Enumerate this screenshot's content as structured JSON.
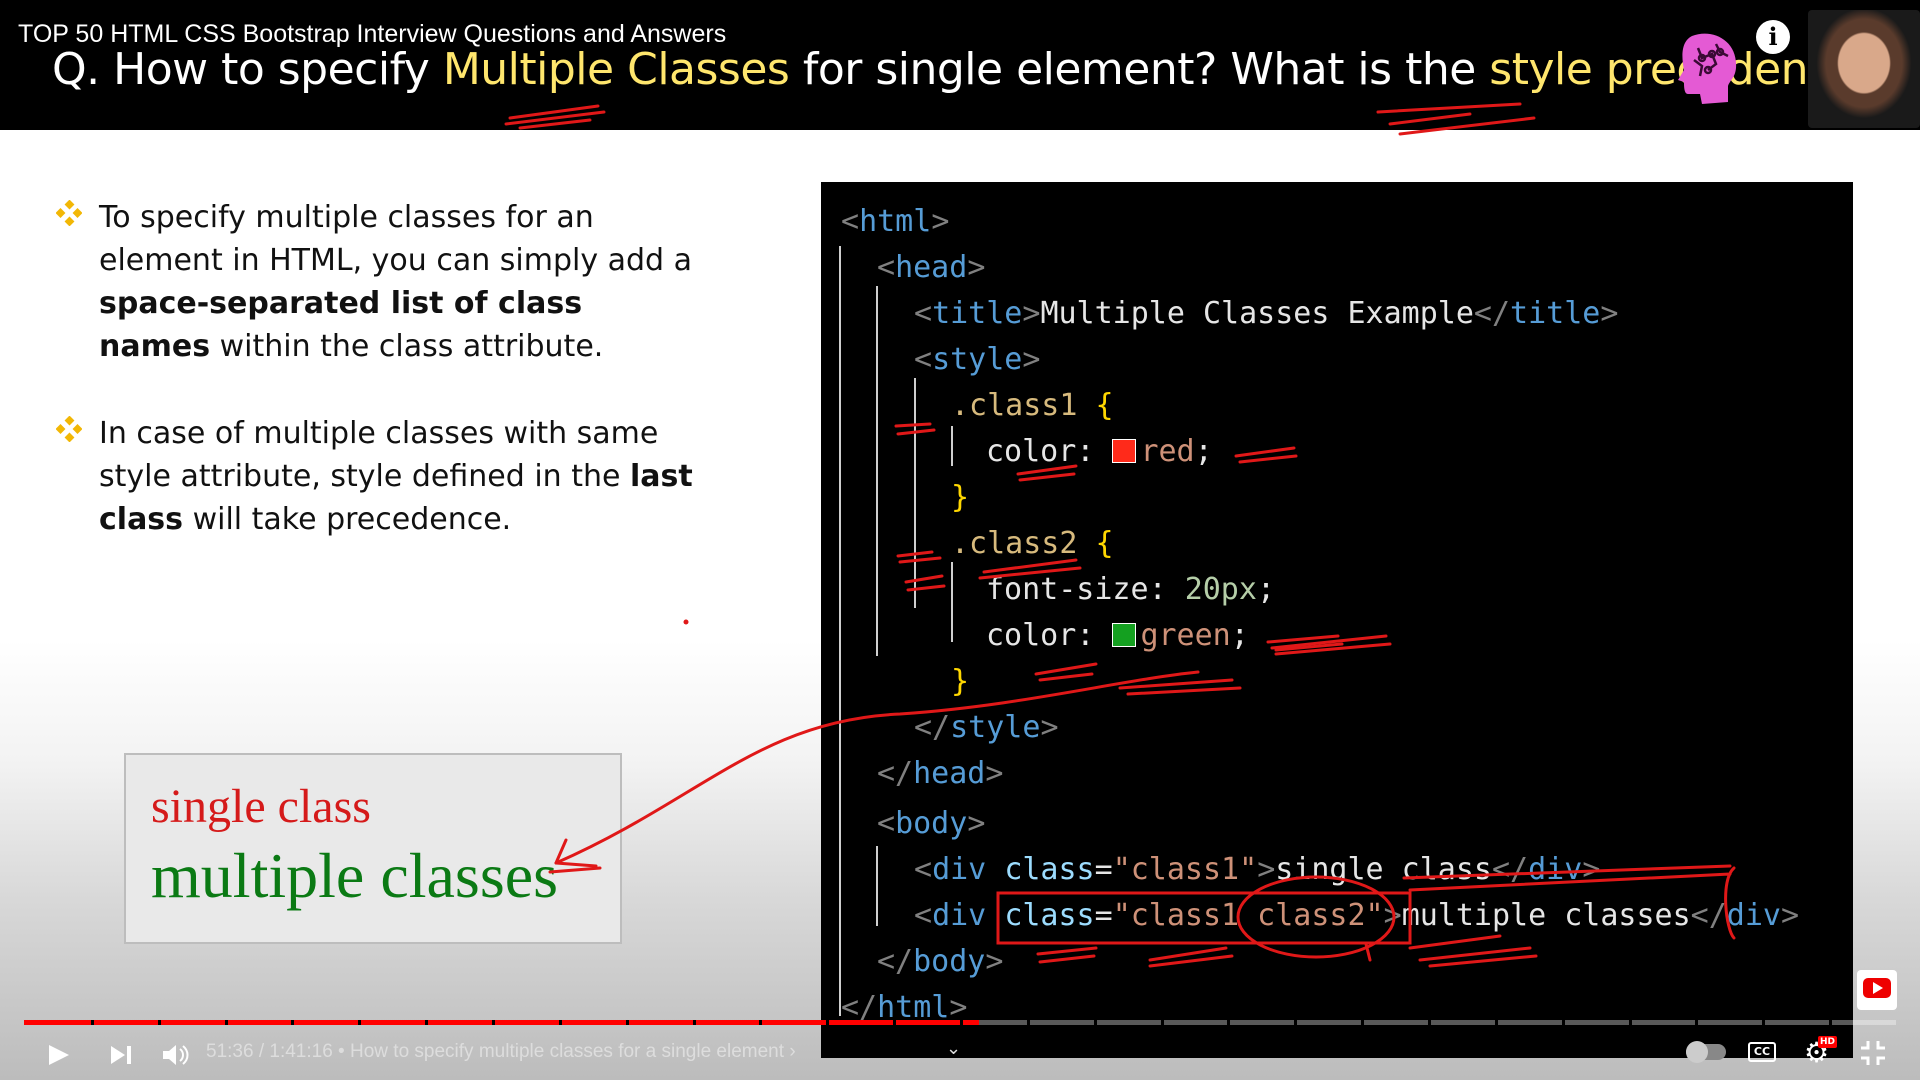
{
  "header": {
    "video_title": "TOP 50 HTML CSS Bootstrap Interview Questions and Answers",
    "question": {
      "q_prefix": "Q. How to specify ",
      "highlight_1": "Multiple Classes",
      "middle": " for single element? What is the ",
      "highlight_2": "style precedence",
      "suffix": "?"
    }
  },
  "bullets": {
    "b1": {
      "part1": "To specify multiple classes for an element in HTML, you can simply add a ",
      "bold": "space-separated list of class names",
      "part2": " within the class attribute."
    },
    "b2": {
      "part1": "In case of multiple classes with same style attribute, style defined in the ",
      "bold": "last class",
      "part2": " will take precedence."
    }
  },
  "example": {
    "single": "single class",
    "multiple": "multiple classes"
  },
  "code": {
    "html_tag": "html",
    "head_tag": "head",
    "title_tag": "title",
    "title_text": "Multiple Classes Example",
    "style_tag": "style",
    "class1_selector": ".class1",
    "class2_selector": ".class2",
    "color_prop": "color",
    "font_size_prop": "font-size",
    "red_value": "red",
    "green_value": "green",
    "font_size_value": "20px",
    "body_tag": "body",
    "div_tag": "div",
    "class_attr": "class",
    "class1_str": "\"class1\"",
    "class1_class2_str": "\"class1 class2\"",
    "single_text": "single class",
    "multiple_text": "multiple classes",
    "colors": {
      "red_swatch": "#ff2a1a",
      "green_swatch": "#14a020"
    }
  },
  "player": {
    "time": "51:36 / 1:41:16",
    "separator": " • ",
    "chapter": "How to specify multiple classes for a single element",
    "chapter_arrow": "›",
    "progress_fraction": 0.51,
    "colors": {
      "progress": "#ff0000"
    }
  },
  "icons": {
    "bullet": "diamond-bullet-icon",
    "info": "info-icon",
    "watch_later": "clock-icon",
    "share": "share-icon",
    "brain": "brain-icon"
  }
}
